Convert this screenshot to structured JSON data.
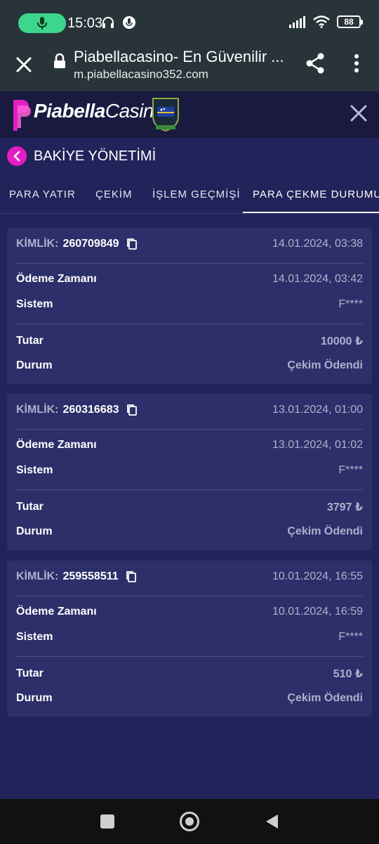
{
  "status": {
    "time": "15:03",
    "battery": "88"
  },
  "browser": {
    "title": "Piabellacasino- En Güvenilir ...",
    "url": "m.piabellacasino352.com"
  },
  "site": {
    "logo_bold": "Piabella",
    "logo_light": "Casino"
  },
  "section": {
    "title": "BAKİYE YÖNETİMİ"
  },
  "tabs": [
    {
      "label": "PARA YATIR"
    },
    {
      "label": "ÇEKİM"
    },
    {
      "label": "İŞLEM GEÇMİŞİ"
    },
    {
      "label": "PARA ÇEKME DURUMU"
    }
  ],
  "labels": {
    "id": "KİMLİK:",
    "payment_time": "Ödeme Zamanı",
    "system": "Sistem",
    "amount": "Tutar",
    "status": "Durum"
  },
  "withdrawals": [
    {
      "id": "260709849",
      "date": "14.01.2024, 03:38",
      "payment_time": "14.01.2024, 03:42",
      "system": "F****",
      "amount": "10000 ₺",
      "status": "Çekim Ödendi"
    },
    {
      "id": "260316683",
      "date": "13.01.2024, 01:00",
      "payment_time": "13.01.2024, 01:02",
      "system": "F****",
      "amount": "3797 ₺",
      "status": "Çekim Ödendi"
    },
    {
      "id": "259558511",
      "date": "10.01.2024, 16:55",
      "payment_time": "10.01.2024, 16:59",
      "system": "F****",
      "amount": "510 ₺",
      "status": "Çekim Ödendi"
    }
  ],
  "colors": {
    "accent": "#e21ec5",
    "amount": "#f0a522",
    "status_paid": "#29b04a",
    "background": "#22235a",
    "card": "#2d2f6a"
  }
}
